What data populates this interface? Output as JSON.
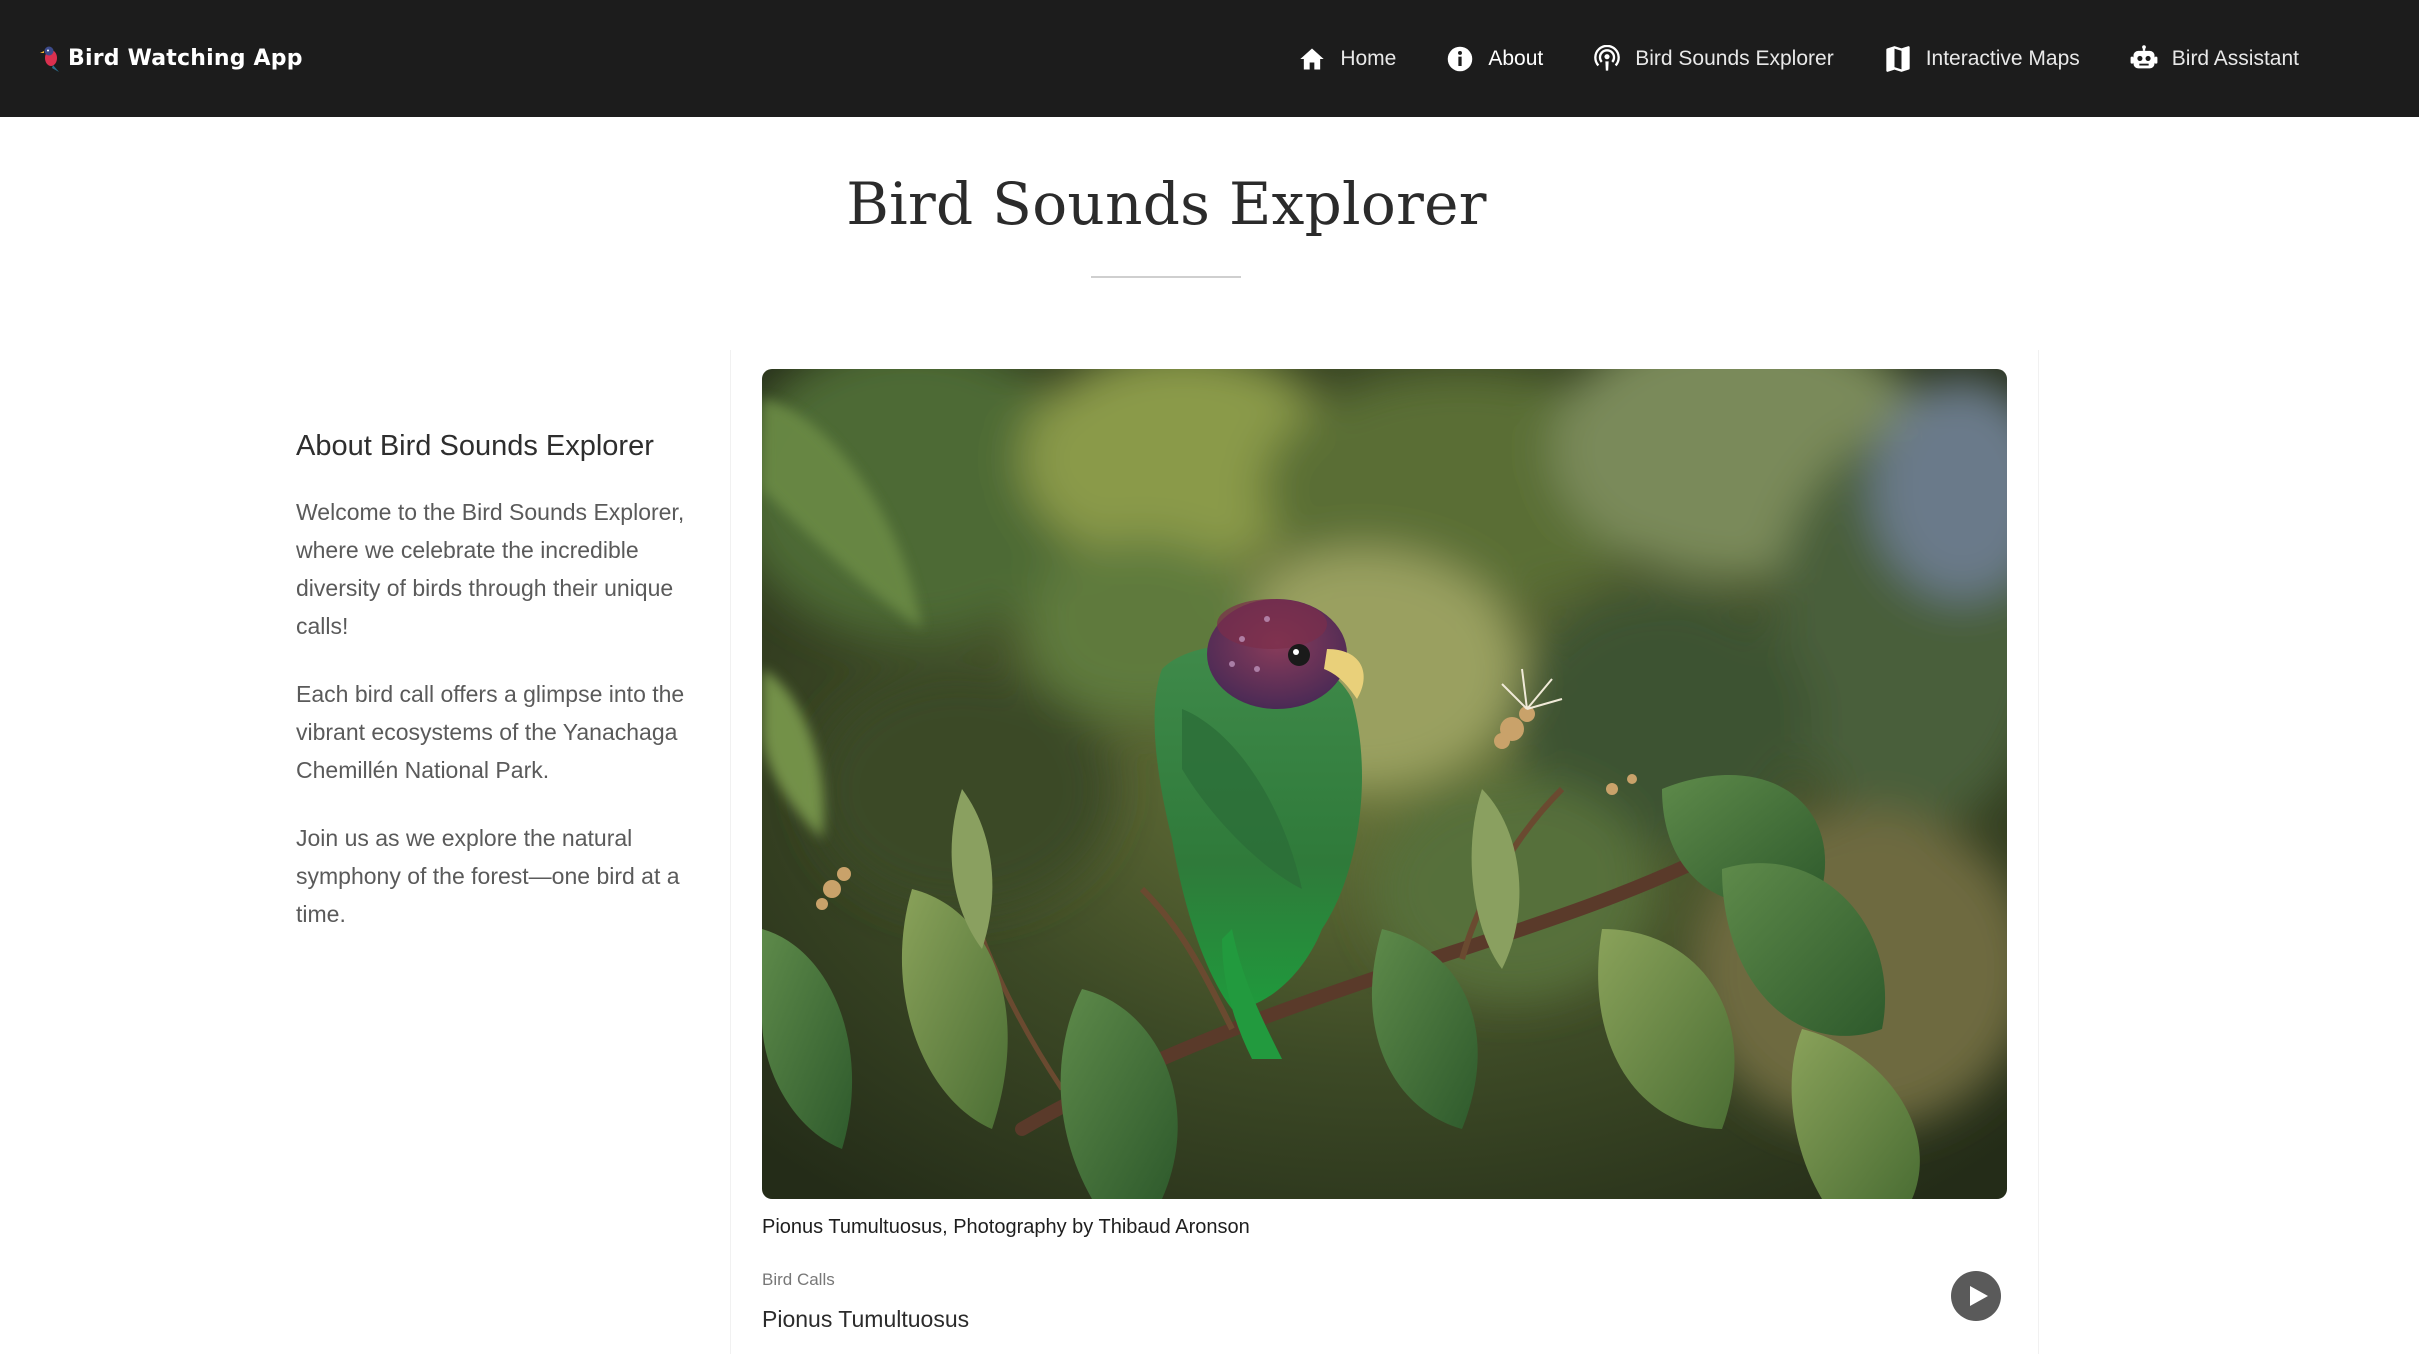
{
  "navbar": {
    "brand": "Bird Watching App",
    "links": [
      {
        "label": "Home",
        "icon": "home-icon"
      },
      {
        "label": "About",
        "icon": "info-icon"
      },
      {
        "label": "Bird Sounds Explorer",
        "icon": "podcast-icon"
      },
      {
        "label": "Interactive Maps",
        "icon": "map-icon"
      },
      {
        "label": "Bird Assistant",
        "icon": "robot-icon"
      }
    ],
    "active": "About"
  },
  "page": {
    "title": "Bird Sounds Explorer"
  },
  "sidebar": {
    "heading": "About Bird Sounds Explorer",
    "paragraphs": [
      "Welcome to the Bird Sounds Explorer, where we celebrate the incredible diversity of birds through their unique calls!",
      "Each bird call offers a glimpse into the vibrant ecosystems of the Yanachaga Chemillén National Park.",
      "Join us as we explore the natural symphony of the forest—one bird at a time."
    ]
  },
  "card": {
    "image_subject": "green parrot with purple head perched among leaves",
    "caption": "Pionus Tumultuosus, Photography by Thibaud Aronson",
    "calls_label": "Bird Calls",
    "bird_name": "Pionus Tumultuosus",
    "play_icon": "play-icon"
  },
  "colors": {
    "navbar_bg": "#1c1c1c",
    "nav_text": "#ffffff",
    "play_button": "#5a5a5a",
    "body_text": "#5a5a5a"
  }
}
